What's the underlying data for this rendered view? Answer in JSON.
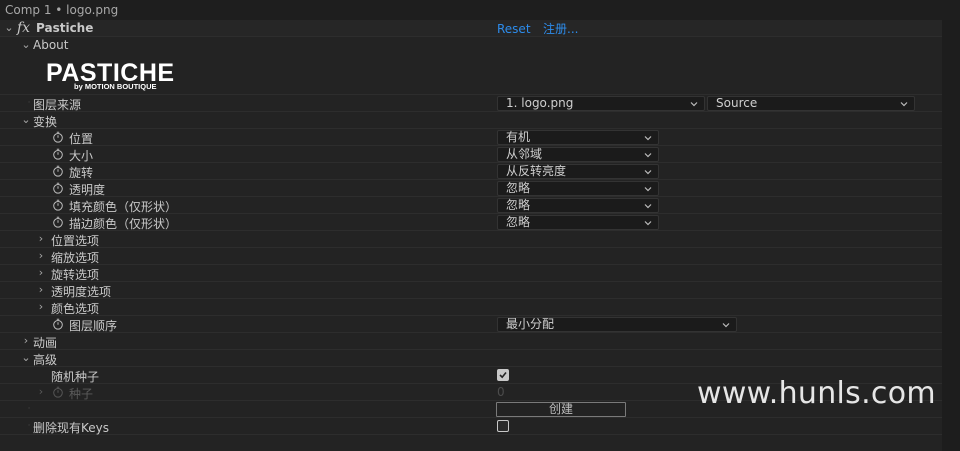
{
  "window": {
    "title": "Comp 1 • logo.png"
  },
  "effect": {
    "name": "Pastiche",
    "reset_label": "Reset",
    "register_label": "注册..."
  },
  "about": {
    "label": "About",
    "logo_text": "PASTICHE",
    "logo_tagline": "by MOTION BOUTIQUE"
  },
  "layer_source": {
    "label": "图层来源",
    "layer_value": "1. logo.png",
    "source_value": "Source"
  },
  "transform": {
    "label": "变换",
    "position": {
      "label": "位置",
      "value": "有机"
    },
    "scale": {
      "label": "大小",
      "value": "从邻域"
    },
    "rotation": {
      "label": "旋转",
      "value": "从反转亮度"
    },
    "opacity": {
      "label": "透明度",
      "value": "忽略"
    },
    "fill_color": {
      "label": "填充颜色（仅形状）",
      "value": "忽略"
    },
    "stroke_color": {
      "label": "描边颜色（仅形状）",
      "value": "忽略"
    },
    "position_options": "位置选项",
    "scale_options": "缩放选项",
    "rotation_options": "旋转选项",
    "opacity_options": "透明度选项",
    "color_options": "颜色选项",
    "layer_order": {
      "label": "图层顺序",
      "value": "最小分配"
    }
  },
  "animation": {
    "label": "动画"
  },
  "advanced": {
    "label": "高级",
    "random_seed": {
      "label": "随机种子",
      "checked": true
    },
    "seed": {
      "label": "种子",
      "value": "0"
    },
    "create_label": "创建"
  },
  "delete_keys": {
    "label": "删除现有Keys",
    "checked": false
  },
  "watermark": "www.hunls.com",
  "colors": {
    "background": "#232323",
    "link": "#2d8ceb",
    "text": "#c8c8c8"
  }
}
